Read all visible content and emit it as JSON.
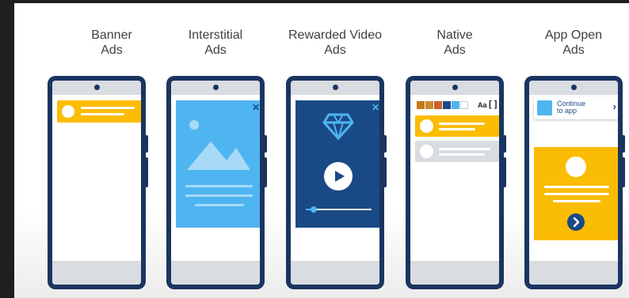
{
  "colors": {
    "frame": "#1a3560",
    "yellow": "#fbbc04",
    "light_blue": "#4fb5f0",
    "dark_blue": "#1a4a86",
    "gray_bar": "#d9dce0"
  },
  "ad_formats": [
    {
      "title_line1": "Banner",
      "title_line2": "Ads"
    },
    {
      "title_line1": "Interstitial",
      "title_line2": "Ads"
    },
    {
      "title_line1": "Rewarded Video",
      "title_line2": "Ads"
    },
    {
      "title_line1": "Native",
      "title_line2": "Ads"
    },
    {
      "title_line1": "App Open",
      "title_line2": "Ads"
    }
  ],
  "interstitial": {
    "close_glyph": "✕",
    "icons": [
      "sun-icon",
      "mountain-icon"
    ]
  },
  "rewarded": {
    "close_glyph": "✕",
    "icons": [
      "diamond-icon",
      "play-icon"
    ],
    "progress": 0.12
  },
  "native": {
    "swatch_colors": [
      "#c9761b",
      "#c98a2e",
      "#d15f2a",
      "#1a4a86",
      "#4fb5f0",
      "#ffffff"
    ],
    "font_label": "Aa",
    "resize_glyph": "[ ]"
  },
  "app_open": {
    "continue_line1": "Continue",
    "continue_line2": "to app",
    "continue_arrow": "›",
    "next_icon": "arrow-right-icon"
  }
}
